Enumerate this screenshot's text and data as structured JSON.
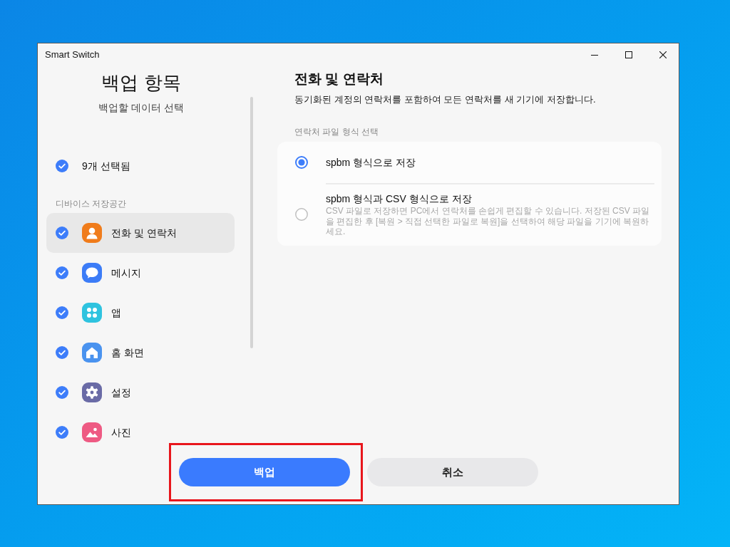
{
  "window": {
    "title": "Smart Switch"
  },
  "sidebar": {
    "title": "백업 항목",
    "subtitle": "백업할 데이터 선택",
    "select_all": {
      "label": "9개 선택됨",
      "checked": true
    },
    "section_label": "디바이스 저장공간",
    "items": [
      {
        "label": "전화 및 연락처",
        "kind": "contacts",
        "checked": true,
        "selected": true
      },
      {
        "label": "메시지",
        "kind": "messages",
        "checked": true,
        "selected": false
      },
      {
        "label": "앱",
        "kind": "apps",
        "checked": true,
        "selected": false
      },
      {
        "label": "홈 화면",
        "kind": "home",
        "checked": true,
        "selected": false
      },
      {
        "label": "설정",
        "kind": "settings",
        "checked": true,
        "selected": false
      },
      {
        "label": "사진",
        "kind": "photos",
        "checked": true,
        "selected": false
      }
    ]
  },
  "detail": {
    "title": "전화 및 연락처",
    "description": "동기화된 계정의 연락처를 포함하여 모든 연락처를 새 기기에 저장합니다.",
    "format_label": "연락처 파일 형식 선택",
    "options": [
      {
        "label": "spbm 형식으로 저장",
        "selected": true
      },
      {
        "label": "spbm 형식과 CSV 형식으로 저장",
        "description": "CSV 파일로 저장하면 PC에서 연락처를 손쉽게 편집할 수 있습니다. 저장된 CSV 파일을 편집한 후 [복원 > 직접 선택한 파일로 복원]을 선택하여 해당 파일을 기기에 복원하세요.",
        "selected": false
      }
    ]
  },
  "footer": {
    "buttons": [
      {
        "label": "백업",
        "kind": "primary",
        "highlighted": true
      },
      {
        "label": "취소",
        "kind": "secondary",
        "highlighted": false
      }
    ]
  }
}
